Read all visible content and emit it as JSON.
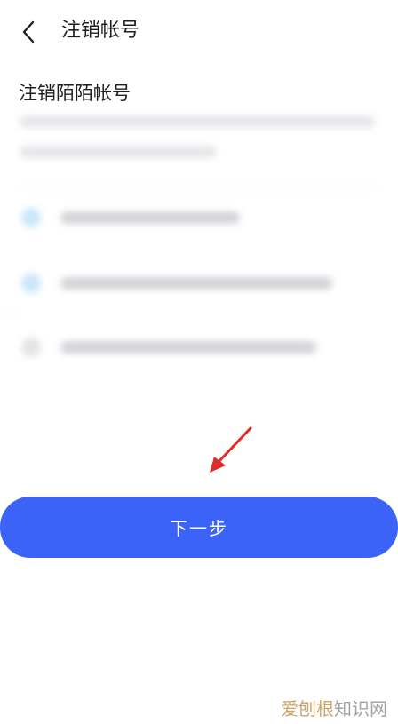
{
  "header": {
    "back_icon": "chevron-left-icon",
    "title": "注销帐号"
  },
  "section": {
    "title": "注销陌陌帐号"
  },
  "actions": {
    "next_label": "下一步"
  },
  "annotation": {
    "arrow_icon": "red-arrow-icon",
    "arrow_color": "#e02b2b"
  },
  "watermark": {
    "part1": "爱刨根",
    "part2": "知识网"
  },
  "colors": {
    "primary": "#3b63f7",
    "background": "#ffffff",
    "text": "#1e1e1e"
  }
}
